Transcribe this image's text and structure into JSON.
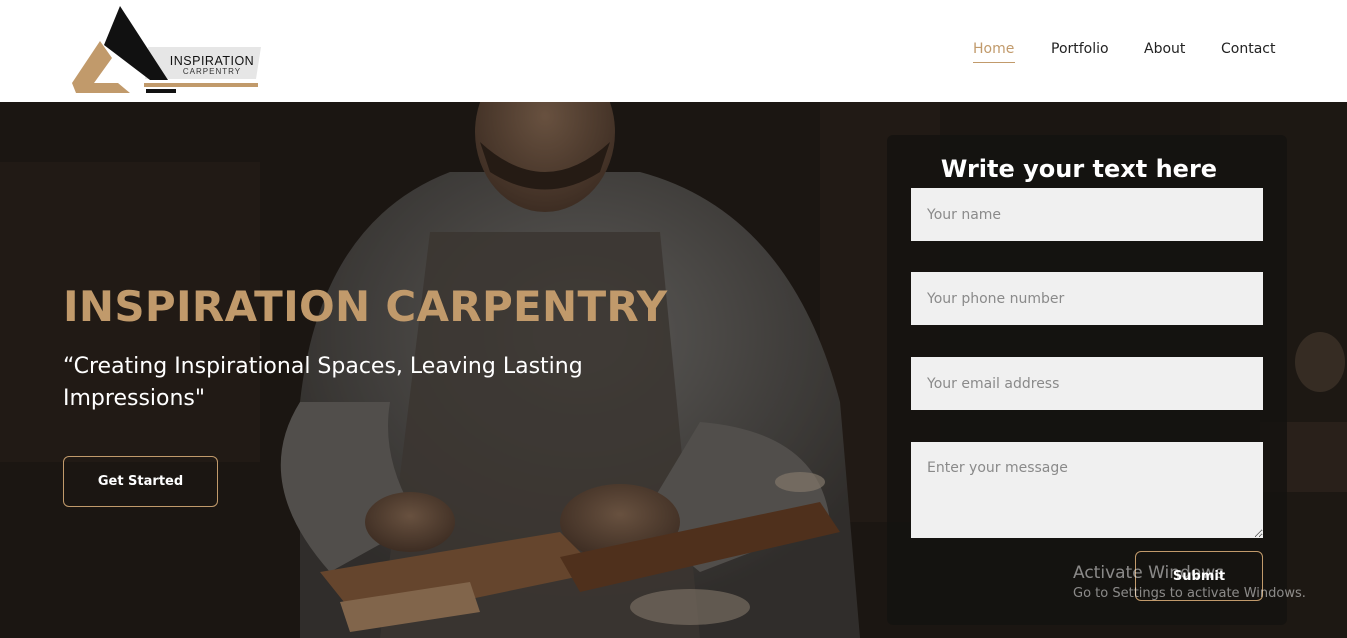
{
  "brand": {
    "name": "INSPIRATION",
    "sub": "CARPENTRY",
    "accent": "#c19a6b"
  },
  "nav": {
    "items": [
      {
        "label": "Home",
        "active": true
      },
      {
        "label": "Portfolio",
        "active": false
      },
      {
        "label": "About",
        "active": false
      },
      {
        "label": "Contact",
        "active": false
      }
    ]
  },
  "hero": {
    "heading": "INSPIRATION CARPENTRY",
    "tagline": "“Creating Inspirational Spaces, Leaving Lasting Impressions\"",
    "cta_label": "Get Started"
  },
  "form": {
    "title": "Write your text here",
    "name_placeholder": "Your name",
    "phone_placeholder": "Your phone number",
    "email_placeholder": "Your email address",
    "message_placeholder": "Enter your message",
    "submit_label": "Submit"
  },
  "watermark": {
    "title": "Activate Windows",
    "subtitle": "Go to Settings to activate Windows."
  }
}
